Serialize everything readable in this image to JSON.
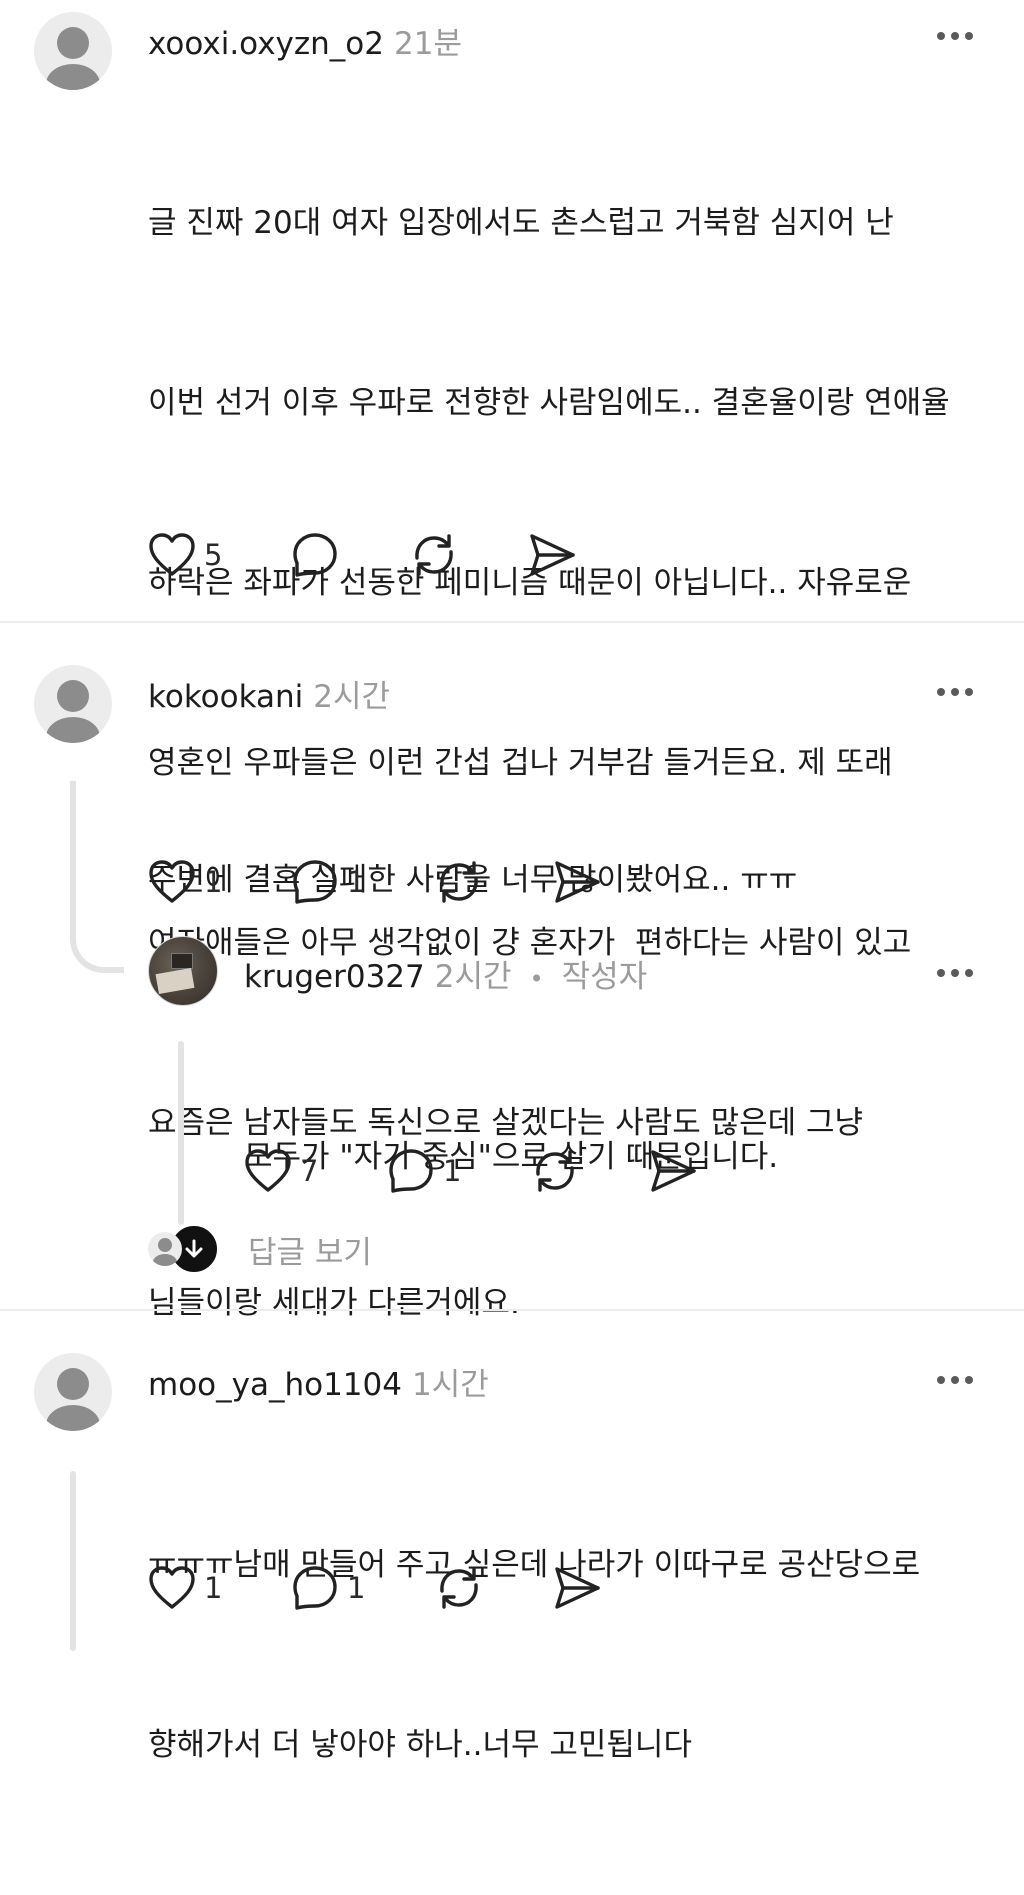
{
  "comments": [
    {
      "username": "xooxi.oxyzn_o2",
      "time": "21분",
      "lines": [
        "글 진짜 20대 여자 입장에서도 촌스럽고 거북함 심지어 난",
        "이번 선거 이후 우파로 전향한 사람임에도.. 결혼율이랑 연애율",
        "하락은 좌파가 선동한 페미니즘 때문이 아닙니다.. 자유로운",
        "영혼인 우파들은 이런 간섭 겁나 거부감 들거든요. 제 또래",
        "여자애들은 아무 생각없이 걍 혼자가  편하다는 사람이 있고",
        "요즘은 남자들도 독신으로 살겠다는 사람도 많은데 그냥",
        "님들이랑 세대가 다른거에요."
      ],
      "likes": "5",
      "replies": ""
    },
    {
      "username": "kokookani",
      "time": "2시간",
      "lines": [
        "주변에 결혼 실패한 사람을 너무 많이봤어요.. ㅠㅠ"
      ],
      "likes": "1",
      "replies": "1",
      "reply": {
        "username": "kruger0327",
        "time": "2시간",
        "separator": "•",
        "badge": "작성자",
        "lines": [
          "모두가 \"자기 중심\"으로 살기 때문입니다."
        ],
        "likes": "7",
        "replies": "1"
      },
      "view_replies_label": "답글 보기"
    },
    {
      "username": "moo_ya_ho1104",
      "time": "1시간",
      "lines": [
        "ㅠㅠㅠ남매 만들어 주고 싶은데 나라가 이따구로 공산당으로",
        "향해가서 더 낳아야 하나..너무 고민됩니다"
      ],
      "likes": "1",
      "replies": "1"
    }
  ],
  "icons": {
    "like": "heart-icon",
    "reply": "comment-bubble-icon",
    "repost": "repost-icon",
    "share": "send-icon",
    "more": "more-dots-icon",
    "view_replies": "arrow-down-icon"
  }
}
